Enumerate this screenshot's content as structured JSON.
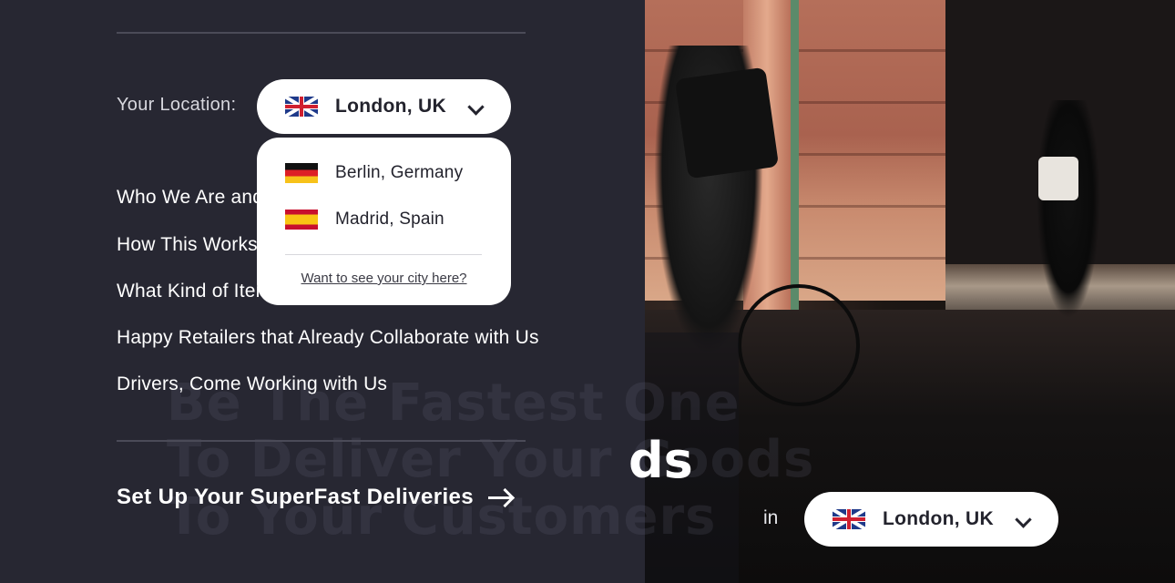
{
  "location": {
    "label": "Your Location:",
    "selected": "London, UK",
    "selected_flag": "uk-flag",
    "options": [
      {
        "label": "Berlin, Germany",
        "flag": "germany-flag"
      },
      {
        "label": "Madrid, Spain",
        "flag": "spain-flag"
      }
    ],
    "request_link": "Want to see your city here?"
  },
  "menu": {
    "items": [
      "Who We Are and",
      "How This Works",
      "What Kind of Items",
      "Happy Retailers that Already Collaborate with Us",
      "Drivers, Come Working with Us"
    ]
  },
  "cta": {
    "label": "Set Up Your SuperFast Deliveries",
    "icon": "arrow-right-icon"
  },
  "hero": {
    "line1": "Be The Fastest One",
    "line2": "To Deliver Your Goods",
    "line3": "To Your Customers",
    "visible_tail": "ds",
    "in_label": "in",
    "selected_location": "London, UK"
  },
  "colors": {
    "panel_bg": "#272732",
    "text_light": "#ffffff",
    "select_bg": "#ffffff",
    "select_text": "#23232d"
  }
}
